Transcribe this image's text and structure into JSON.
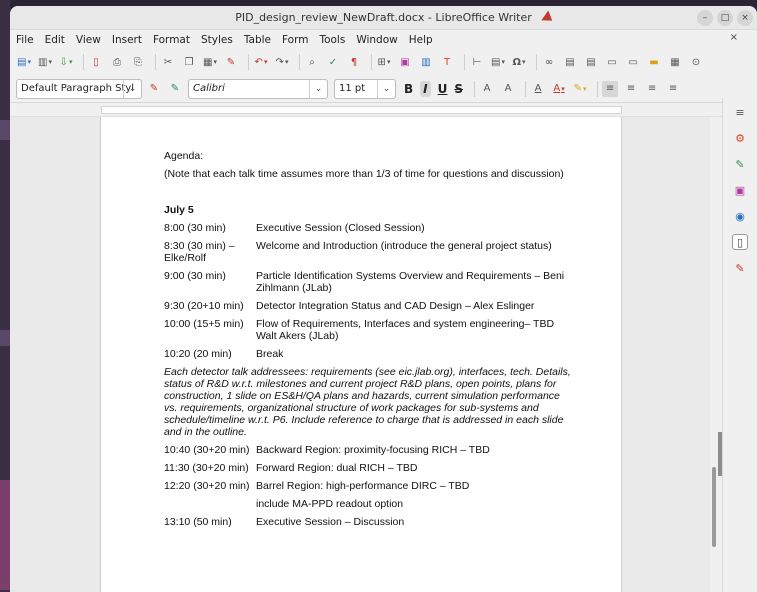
{
  "window": {
    "title": "PID_design_review_NewDraft.docx - LibreOffice Writer",
    "controls": {
      "minimize": "–",
      "maximize": "□",
      "close": "×"
    }
  },
  "menubar": {
    "items": [
      "File",
      "Edit",
      "View",
      "Insert",
      "Format",
      "Styles",
      "Table",
      "Form",
      "Tools",
      "Window",
      "Help"
    ],
    "close_doc": "×"
  },
  "format_toolbar": {
    "paragraph_style": "Default Paragraph Styl",
    "font_name": "Calibri",
    "font_size": "11 pt",
    "bold": "B",
    "italic": "I",
    "underline": "U",
    "strike": "S"
  },
  "document": {
    "agenda_label": "Agenda:",
    "note": "(Note that each talk time assumes more than 1/3 of time for questions and discussion)",
    "day_heading": "July 5",
    "rows1": [
      {
        "time": "8:00 (30 min)",
        "desc": "Executive Session (Closed Session)"
      },
      {
        "time": "8:30 (30 min) – Elke/Rolf",
        "desc": "Welcome and Introduction (introduce the general project status)"
      },
      {
        "time": "9:00 (30 min)",
        "desc": "Particle Identification Systems Overview and Requirements – Beni Zihlmann (JLab)"
      },
      {
        "time": "9:30 (20+10 min)",
        "desc": "Detector Integration Status and CAD Design – Alex Eslinger"
      },
      {
        "time": "10:00 (15+5 min)",
        "desc": "Flow of Requirements, Interfaces and system engineering– TBD Walt Akers (JLab)"
      },
      {
        "time": "10:20 (20 min)",
        "desc": "Break"
      }
    ],
    "italic_note": "Each detector talk addressees: requirements (see eic.jlab.org), interfaces, tech. Details, status of R&D w.r.t. milestones and current project R&D plans, open points, plans for construction, 1 slide on ES&H/QA plans and hazards, current simulation performance vs. requirements, organizational structure of work packages for sub-systems and  schedule/timeline w.r.t. P6. Include reference to charge that is addressed in each slide and in the outline.",
    "rows2": [
      {
        "time": "10:40 (30+20 min)",
        "desc": "Backward Region: proximity-focusing RICH – TBD"
      },
      {
        "time": "11:30 (30+20 min)",
        "desc": "Forward Region: dual RICH – TBD"
      },
      {
        "time": "12:20 (30+20 min)",
        "desc": "Barrel Region: high-performance DIRC – TBD"
      },
      {
        "time": "",
        "desc": "include MA-PPD readout option"
      },
      {
        "time": "13:10 (50 min)",
        "desc": "Executive Session – Discussion"
      }
    ]
  },
  "icons": {
    "toolbar1": [
      "new-document-icon",
      "templates-icon",
      "open-icon",
      "export-pdf-icon",
      "print-icon",
      "print-preview-icon",
      "cut-icon",
      "copy-icon",
      "paste-icon",
      "clone-formatting-icon",
      "undo-icon",
      "redo-icon",
      "find-replace-icon",
      "spellcheck-icon",
      "formatting-marks-icon",
      "insert-table-icon",
      "insert-image-icon",
      "insert-chart-icon",
      "insert-textbox-icon",
      "insert-page-break-icon",
      "insert-field-icon",
      "special-character-icon",
      "hyperlink-icon",
      "footnote-icon",
      "endnote-icon",
      "bookmark-icon",
      "cross-reference-icon",
      "comment-icon",
      "track-changes-icon",
      "line-icon"
    ],
    "sidebar": [
      "sidebar-menu-icon",
      "properties-icon",
      "styles-icon",
      "gallery-icon",
      "navigator-icon",
      "page-icon",
      "style-inspector-icon"
    ]
  },
  "colors": {
    "accent": "#e0431b",
    "selection": "#d7d7d7"
  }
}
